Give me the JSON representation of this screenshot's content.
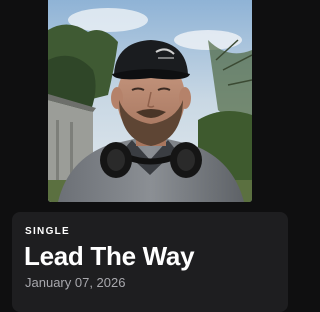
{
  "release": {
    "type_label": "SINGLE",
    "title": "Lead The Way",
    "date": "January 07, 2026"
  },
  "cover_art": {
    "description": "cover-art-photo"
  }
}
